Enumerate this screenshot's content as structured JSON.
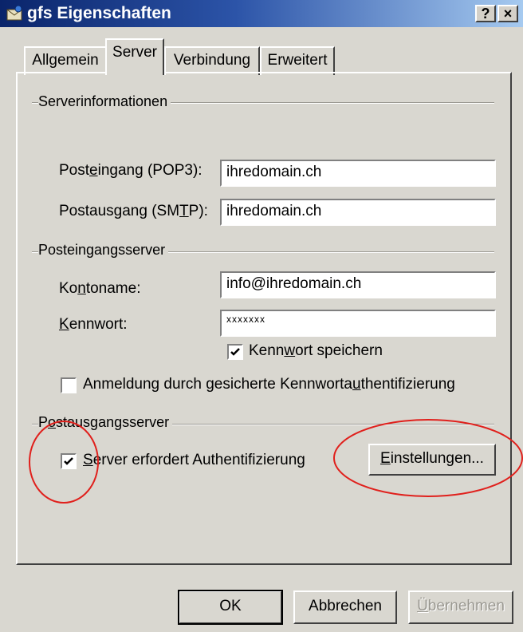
{
  "window": {
    "title": "gfs Eigenschaften",
    "help_button": "?",
    "close_button": "×"
  },
  "tabs": [
    {
      "label": "Allgemein"
    },
    {
      "label": "Server"
    },
    {
      "label": "Verbindung"
    },
    {
      "label": "Erweitert"
    }
  ],
  "server_info": {
    "group_label": "Serverinformationen",
    "incoming_label": {
      "pre": "Post",
      "acc": "e",
      "post": "ingang (POP3):"
    },
    "incoming_value": "ihredomain.ch",
    "outgoing_label": {
      "pre": "Postausgang (SM",
      "acc": "T",
      "post": "P):"
    },
    "outgoing_value": "ihredomain.ch"
  },
  "incoming_server": {
    "group_label": "Posteingangsserver",
    "account_label": {
      "pre": "Ko",
      "acc": "n",
      "post": "toname:"
    },
    "account_value": "info@ihredomain.ch",
    "password_label": {
      "pre": "",
      "acc": "K",
      "post": "ennwort:"
    },
    "password_value": "xxxxxxx",
    "save_password": {
      "pre": "Kenn",
      "acc": "w",
      "post": "ort speichern",
      "checked": true
    },
    "spa": {
      "pre": "Anmeldung durch gesicherte Kennworta",
      "acc": "u",
      "post": "thentifizierung",
      "checked": false
    }
  },
  "outgoing_server": {
    "group_label": {
      "pre": "P",
      "acc": "o",
      "post": "stausgangsserver"
    },
    "auth_required": {
      "pre": "",
      "acc": "S",
      "post": "erver erfordert Authentifizierung",
      "checked": true
    },
    "settings_button": {
      "pre": "",
      "acc": "E",
      "post": "instellungen..."
    }
  },
  "buttons": {
    "ok": "OK",
    "cancel": "Abbrechen",
    "apply": {
      "pre": "",
      "acc": "Ü",
      "post": "bernehmen"
    }
  },
  "colors": {
    "title_gradient_start": "#0a246a",
    "title_gradient_end": "#a6caf0",
    "annotation_red": "#e0201c",
    "dialog_face": "#d9d7d0"
  }
}
